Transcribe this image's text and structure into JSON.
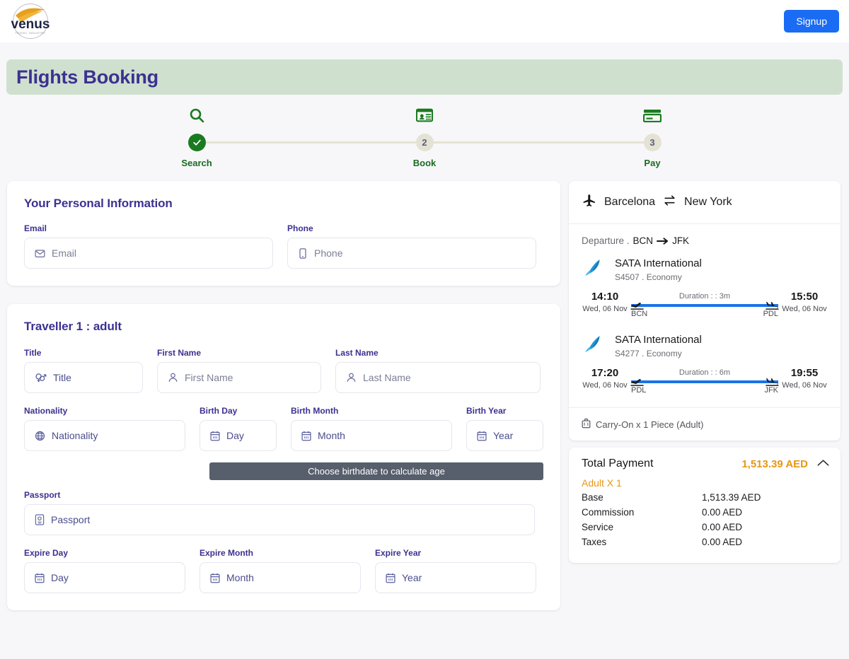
{
  "brand": {
    "name": "venus",
    "tagline": "TRAVEL INDUSTRY"
  },
  "topbar": {
    "signup_label": "Signup"
  },
  "banner": {
    "title": "Flights Booking",
    "bg": "#cfe0cf",
    "text_color": "#3c3190"
  },
  "stepper": {
    "steps": [
      {
        "icon": "search-icon",
        "marker": "✓",
        "label": "Search",
        "state": "done"
      },
      {
        "icon": "id-card-icon",
        "marker": "2",
        "label": "Book",
        "state": "pending"
      },
      {
        "icon": "credit-card-icon",
        "marker": "3",
        "label": "Pay",
        "state": "pending"
      }
    ],
    "done_color": "#1a7a1f",
    "pending_color": "#e4e2d4"
  },
  "personal": {
    "title": "Your Personal Information",
    "fields": [
      {
        "label": "Email",
        "placeholder": "Email",
        "icon": "envelope-icon"
      },
      {
        "label": "Phone",
        "placeholder": "Phone",
        "icon": "mobile-icon"
      }
    ]
  },
  "traveller": {
    "title": "Traveller 1 : adult",
    "name_row": [
      {
        "label": "Title",
        "placeholder": "Title",
        "icon": "gender-icon"
      },
      {
        "label": "First Name",
        "placeholder": "First Name",
        "icon": "user-icon"
      },
      {
        "label": "Last Name",
        "placeholder": "Last Name",
        "icon": "user-icon"
      }
    ],
    "birth_row": [
      {
        "label": "Nationality",
        "placeholder": "Nationality",
        "icon": "globe-icon"
      },
      {
        "label": "Birth Day",
        "placeholder": "Day",
        "icon": "calendar-icon"
      },
      {
        "label": "Birth Month",
        "placeholder": "Month",
        "icon": "calendar-icon"
      },
      {
        "label": "Birth Year",
        "placeholder": "Year",
        "icon": "calendar-icon"
      }
    ],
    "age_hint": "Choose birthdate to calculate age",
    "passport": {
      "label": "Passport",
      "placeholder": "Passport",
      "icon": "passport-icon"
    },
    "expire_row": [
      {
        "label": "Expire Day",
        "placeholder": "Day",
        "icon": "calendar-icon"
      },
      {
        "label": "Expire Month",
        "placeholder": "Month",
        "icon": "calendar-icon"
      },
      {
        "label": "Expire Year",
        "placeholder": "Year",
        "icon": "calendar-icon"
      }
    ]
  },
  "itinerary": {
    "origin_city": "Barcelona",
    "destination_city": "New York",
    "direction_label": "Departure .",
    "route": "BCN",
    "route_to": "JFK",
    "legs": [
      {
        "airline": "SATA International",
        "flight": "S4507 . Economy",
        "depart_time": "14:10",
        "depart_date": "Wed, 06 Nov",
        "depart_code": "BCN",
        "duration": "Duration : : 3m",
        "arrive_time": "15:50",
        "arrive_date": "Wed, 06 Nov",
        "arrive_code": "PDL"
      },
      {
        "airline": "SATA International",
        "flight": "S4277 . Economy",
        "depart_time": "17:20",
        "depart_date": "Wed, 06 Nov",
        "depart_code": "PDL",
        "duration": "Duration : : 6m",
        "arrive_time": "19:55",
        "arrive_date": "Wed, 06 Nov",
        "arrive_code": "JFK"
      }
    ],
    "baggage": "Carry-On x 1 Piece (Adult)"
  },
  "payment": {
    "title": "Total Payment",
    "total": "1,513.39 AED",
    "accent": "#e79716",
    "pax_label": "Adult X 1",
    "lines": [
      {
        "key": "Base",
        "value": "1,513.39 AED"
      },
      {
        "key": "Commission",
        "value": "0.00 AED"
      },
      {
        "key": "Service",
        "value": "0.00 AED"
      },
      {
        "key": "Taxes",
        "value": "0.00 AED"
      }
    ]
  }
}
